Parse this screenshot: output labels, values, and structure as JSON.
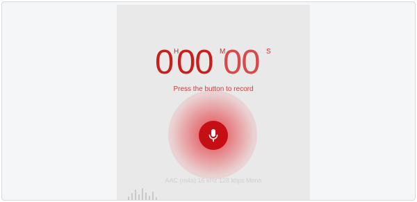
{
  "timer": {
    "hours": "0",
    "hours_unit": "H",
    "minutes": "00",
    "minutes_unit": "M",
    "seconds": "00",
    "seconds_unit": "S"
  },
  "hint": "Press the button to record",
  "record_button": {
    "icon": "microphone-icon"
  },
  "format_info": "AAC (m4a) 16 kHz 128 kbps Mono",
  "waveform_icon": "sound-bars-icon",
  "colors": {
    "accent": "#c50f15",
    "text_red": "#c81e1e",
    "app_bg": "#e9e9e9",
    "page_bg": "#f5f6f8",
    "muted": "#cfcfcf"
  }
}
